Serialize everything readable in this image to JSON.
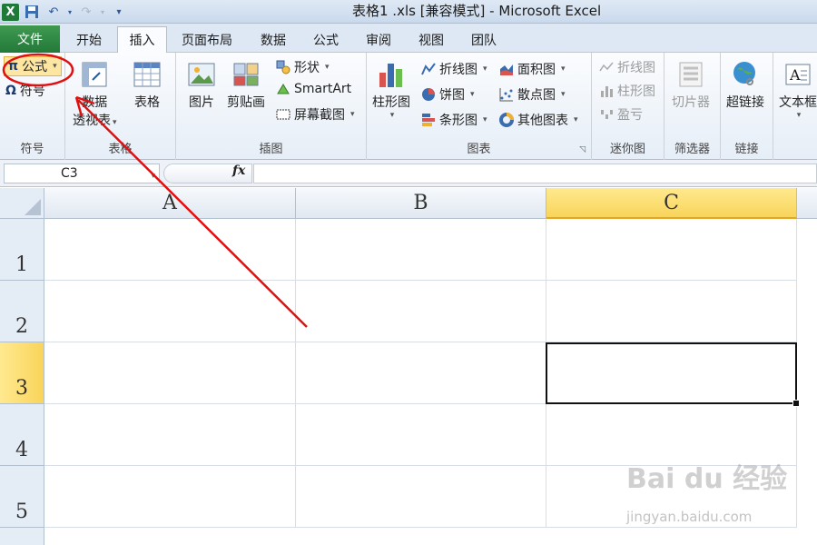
{
  "window": {
    "title": "表格1 .xls [兼容模式] - Microsoft Excel",
    "qat": [
      "excel-logo",
      "save-icon",
      "undo-icon",
      "redo-icon",
      "customize-icon"
    ]
  },
  "tabs": {
    "file": "文件",
    "items": [
      "开始",
      "插入",
      "页面布局",
      "数据",
      "公式",
      "审阅",
      "视图",
      "团队"
    ],
    "active": "插入"
  },
  "ribbon": {
    "symbols": {
      "formula": "公式",
      "symbol": "符号",
      "label": "符号"
    },
    "tables": {
      "pivot_line1": "数据",
      "pivot_line2": "透视表",
      "table": "表格",
      "label": "表格"
    },
    "illustrations": {
      "picture": "图片",
      "clipart": "剪贴画",
      "shapes": "形状",
      "smartart": "SmartArt",
      "screenshot": "屏幕截图",
      "label": "插图"
    },
    "charts": {
      "column": "柱形图",
      "line": "折线图",
      "pie": "饼图",
      "bar": "条形图",
      "area": "面积图",
      "scatter": "散点图",
      "other": "其他图表",
      "label": "图表"
    },
    "sparklines": {
      "line": "折线图",
      "column": "柱形图",
      "winloss": "盈亏",
      "label": "迷你图"
    },
    "filter": {
      "slicer": "切片器",
      "label": "筛选器"
    },
    "links": {
      "hyperlink": "超链接",
      "label": "链接"
    },
    "text": {
      "textbox": "文本框"
    }
  },
  "formula_bar": {
    "name_box": "C3",
    "fx": "fx",
    "value": ""
  },
  "grid": {
    "columns": [
      "A",
      "B",
      "C"
    ],
    "rows": [
      "1",
      "2",
      "3",
      "4",
      "5"
    ],
    "selected_cell": "C3"
  },
  "watermark": {
    "main": "Bai du 经验",
    "sub": "jingyan.baidu.com"
  },
  "colors": {
    "file_tab": "#2a8a43",
    "highlight": "#f9d45a",
    "annotation": "#e01010"
  }
}
